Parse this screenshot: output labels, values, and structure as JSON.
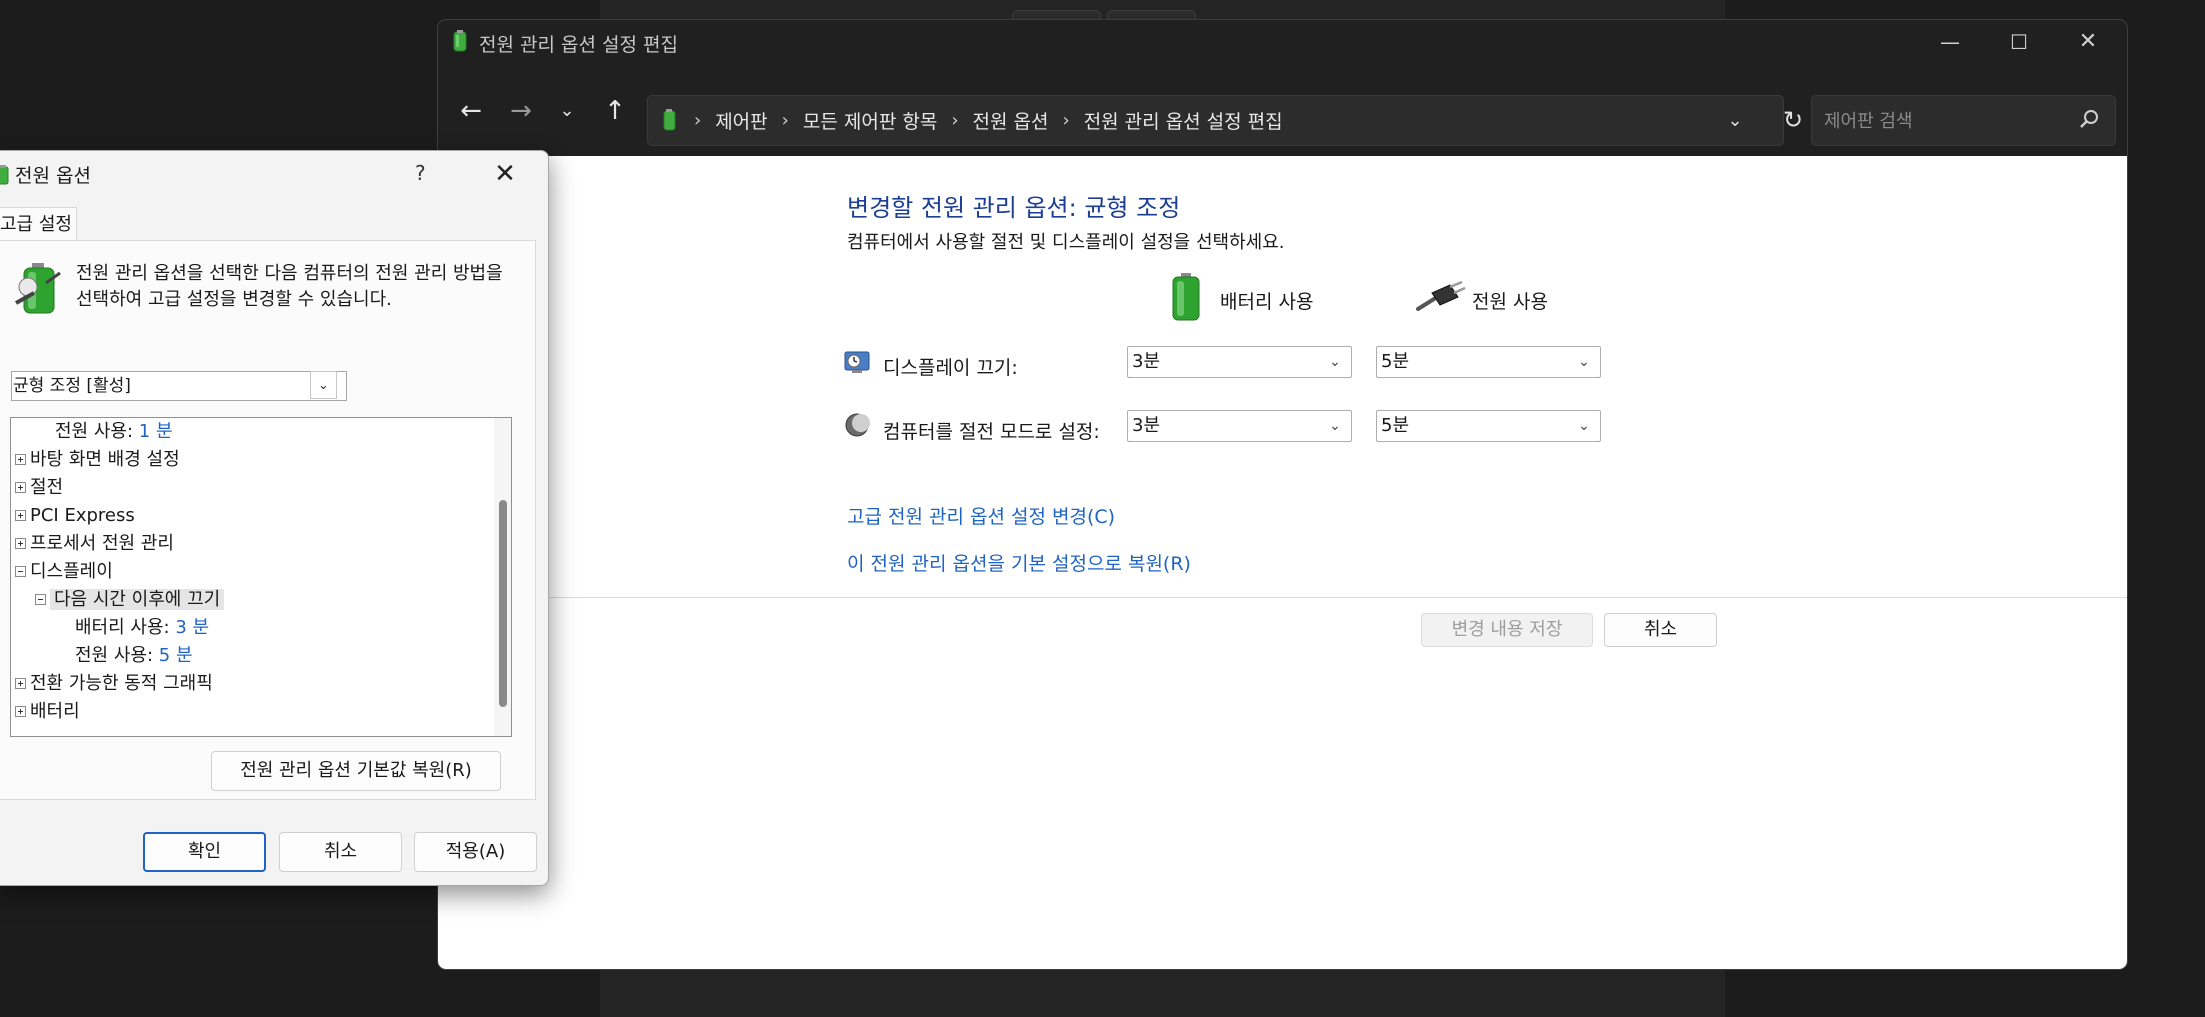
{
  "main_window": {
    "title": "전원 관리 옵션 설정 편집",
    "breadcrumbs": [
      "제어판",
      "모든 제어판 항목",
      "전원 옵션",
      "전원 관리 옵션 설정 편집"
    ],
    "search_placeholder": "제어판 검색",
    "heading": "변경할 전원 관리 옵션: 균형 조정",
    "subheading": "컴퓨터에서 사용할 절전 및 디스플레이 설정을 선택하세요.",
    "col_battery": "배터리 사용",
    "col_plugged": "전원 사용",
    "rows": [
      {
        "label": "디스플레이 끄기:",
        "battery": "3분",
        "plugged": "5분"
      },
      {
        "label": "컴퓨터를 절전 모드로 설정:",
        "battery": "3분",
        "plugged": "5분"
      }
    ],
    "link_advanced": "고급 전원 관리 옵션 설정 변경(C)",
    "link_restore": "이 전원 관리 옵션을 기본 설정으로 복원(R)",
    "btn_save": "변경 내용 저장",
    "btn_cancel": "취소",
    "colors": {
      "heading": "#1c3f94",
      "link": "#1f63c4"
    }
  },
  "dialog": {
    "title": "전원 옵션",
    "help": "?",
    "tab": "고급 설정",
    "description": "전원 관리 옵션을 선택한 다음 컴퓨터의 전원 관리 방법을 선택하여 고급 설정을 변경할 수 있습니다.",
    "plan": "균형 조정 [활성]",
    "tree": [
      {
        "label": "전원 사용:",
        "value": "1 분"
      },
      {
        "label": "바탕 화면 배경 설정"
      },
      {
        "label": "절전"
      },
      {
        "label": "PCI Express"
      },
      {
        "label": "프로세서 전원 관리"
      },
      {
        "label": "디스플레이"
      },
      {
        "label": "다음 시간 이후에 끄기"
      },
      {
        "label": "배터리 사용:",
        "value": "3 분"
      },
      {
        "label": "전원 사용:",
        "value": "5 분"
      },
      {
        "label": "전환 가능한 동적 그래픽"
      },
      {
        "label": "배터리"
      }
    ],
    "btn_restore_defaults": "전원 관리 옵션 기본값 복원(R)",
    "btn_ok": "확인",
    "btn_cancel": "취소",
    "btn_apply": "적용(A)"
  }
}
